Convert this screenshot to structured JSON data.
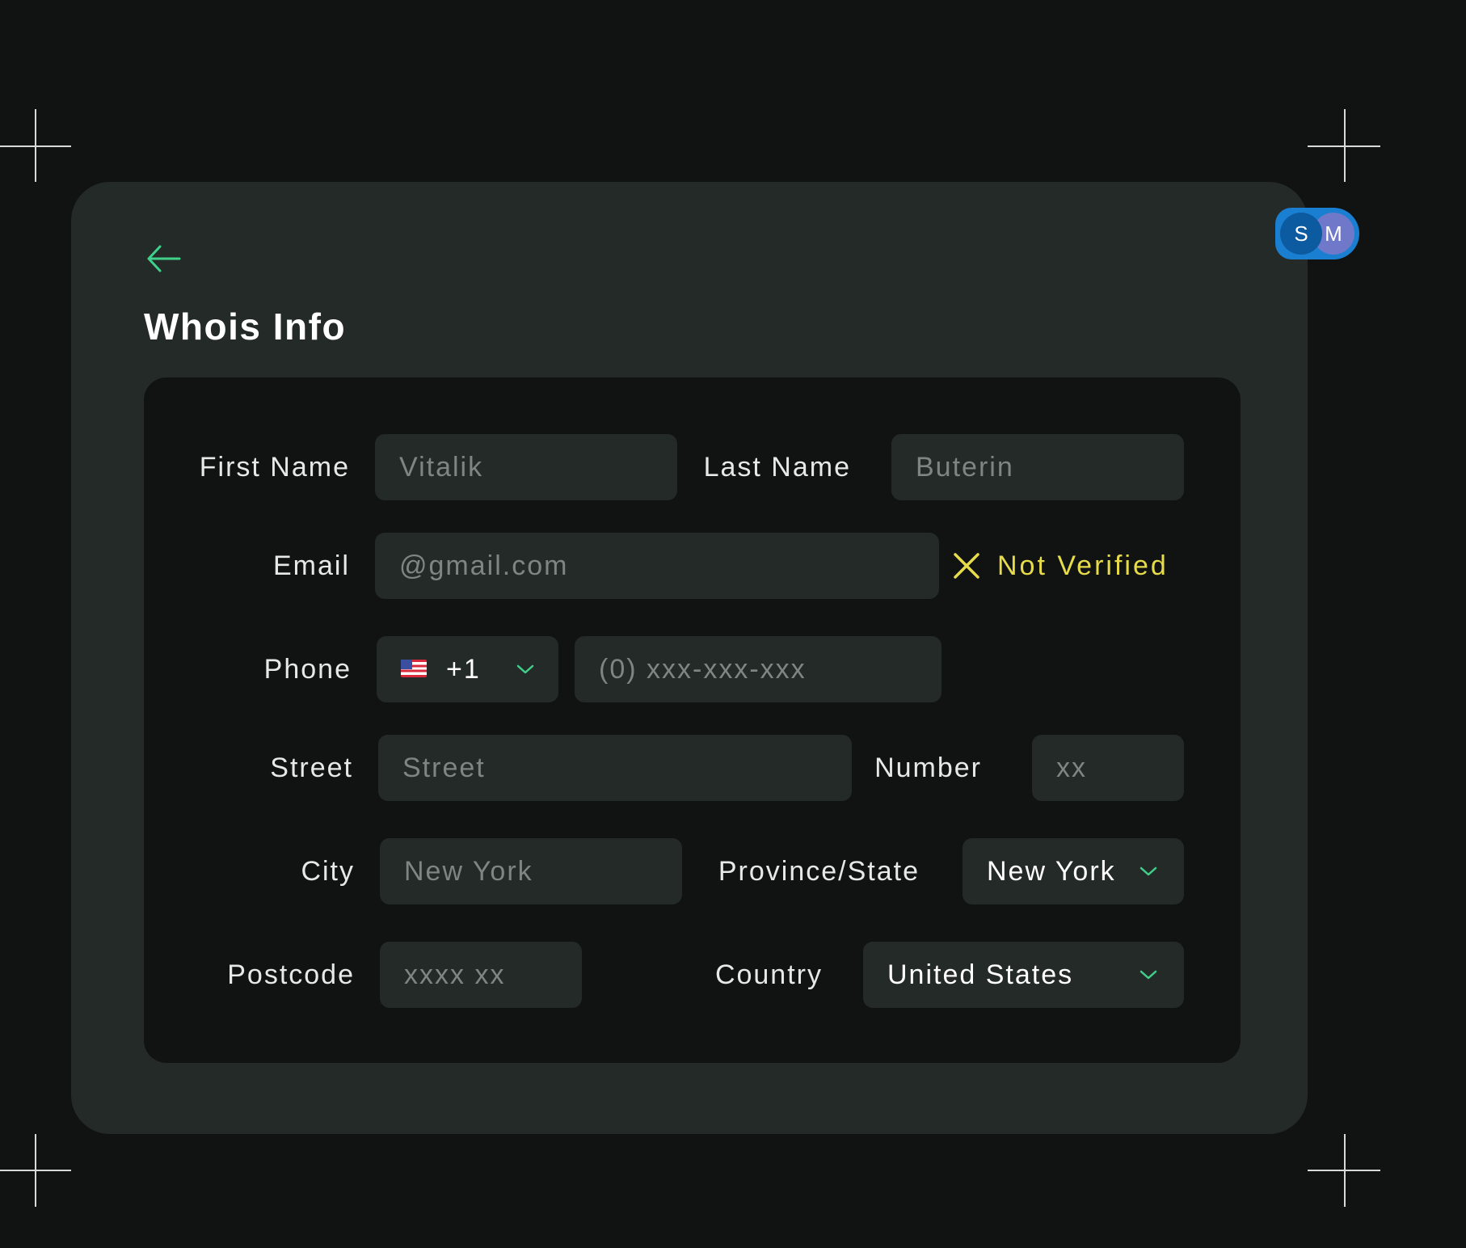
{
  "page": {
    "title": "Whois Info",
    "back_icon": "arrow-left-icon"
  },
  "form": {
    "first_name": {
      "label": "First Name",
      "placeholder": "Vitalik"
    },
    "last_name": {
      "label": "Last Name",
      "placeholder": "Buterin"
    },
    "email": {
      "label": "Email",
      "placeholder": "@gmail.com",
      "status_text": "Not Verified",
      "status_icon": "x-icon",
      "status_color": "#e6db4a"
    },
    "phone": {
      "label": "Phone",
      "country_code": "+1",
      "flag_icon": "us-flag-icon",
      "placeholder": "(0) xxx-xxx-xxx"
    },
    "street": {
      "label": "Street",
      "placeholder": "Street"
    },
    "number": {
      "label": "Number",
      "placeholder": "xx"
    },
    "city": {
      "label": "City",
      "placeholder": "New York"
    },
    "province": {
      "label": "Province/State",
      "value": "New York"
    },
    "postcode": {
      "label": "Postcode",
      "placeholder": "xxxx xx"
    },
    "country": {
      "label": "Country",
      "value": "United States"
    }
  },
  "collaborators": [
    {
      "initial": "S"
    },
    {
      "initial": "M"
    }
  ],
  "colors": {
    "accent": "#3fd18a",
    "warning": "#e6db4a",
    "background": "#111212",
    "card": "#242a28"
  }
}
